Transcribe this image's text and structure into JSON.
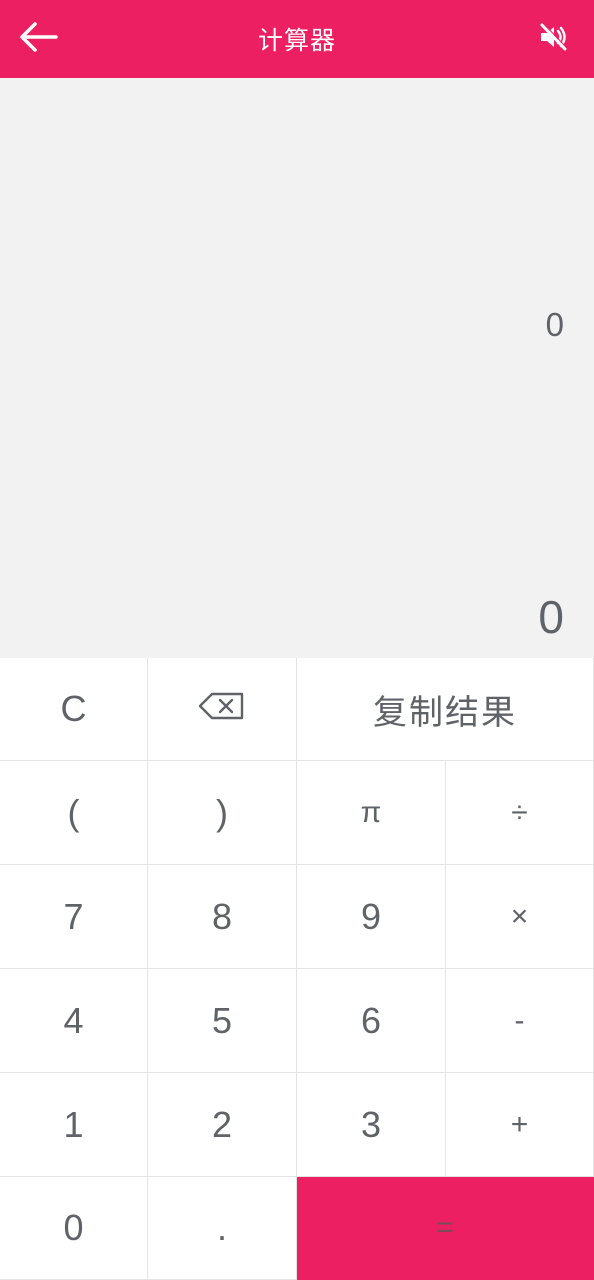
{
  "app_bar": {
    "title": "计算器",
    "back_icon": "arrow-left-icon",
    "mute_icon": "volume-off-icon",
    "color": "#ec1f63"
  },
  "display": {
    "expression": "0",
    "result": "0"
  },
  "keypad": {
    "clear": "C",
    "backspace_icon": "backspace-icon",
    "copy_result": "复制结果",
    "open_paren": "(",
    "close_paren": ")",
    "pi": "π",
    "divide": "÷",
    "seven": "7",
    "eight": "8",
    "nine": "9",
    "multiply": "×",
    "four": "4",
    "five": "5",
    "six": "6",
    "minus": "-",
    "one": "1",
    "two": "2",
    "three": "3",
    "plus": "+",
    "zero": "0",
    "dot": ".",
    "equals": "="
  }
}
